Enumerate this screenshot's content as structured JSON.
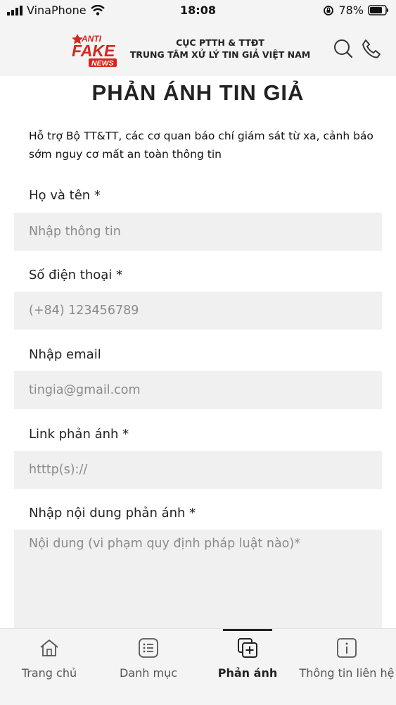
{
  "status_bar": {
    "carrier": "VinaPhone",
    "time": "18:08",
    "battery": "78%"
  },
  "header": {
    "logo": {
      "line1": "ANTI",
      "line2": "FAKE",
      "line3": "NEWS"
    },
    "org_line1": "CỤC PTTH & TTĐT",
    "org_line2": "TRUNG TÂM XỬ LÝ TIN GIẢ VIỆT NAM",
    "icons": [
      "search-icon",
      "phone-icon"
    ]
  },
  "page": {
    "title": "PHẢN ÁNH TIN GIẢ",
    "description": "Hỗ trợ Bộ TT&TT, các cơ quan báo chí giám sát từ xa, cảnh báo sớm nguy cơ mất an toàn thông tin"
  },
  "form": {
    "name": {
      "label": "Họ và tên *",
      "placeholder": "Nhập thông tin"
    },
    "phone": {
      "label": "Số điện thoại *",
      "placeholder": "(+84) 123456789"
    },
    "email": {
      "label": "Nhập email",
      "placeholder": "tingia@gmail.com"
    },
    "link": {
      "label": "Link phản ánh *",
      "placeholder": "htttp(s)://"
    },
    "content": {
      "label": "Nhập nội dung phản ánh *",
      "placeholder": "Nội dung (vi phạm quy định pháp luật nào)*"
    }
  },
  "tabbar": {
    "items": [
      {
        "label": "Trang chủ",
        "icon": "home-icon"
      },
      {
        "label": "Danh mục",
        "icon": "list-icon"
      },
      {
        "label": "Phản ánh",
        "icon": "add-report-icon",
        "active": true
      },
      {
        "label": "Thông tin liên hệ",
        "icon": "info-icon"
      }
    ]
  },
  "colors": {
    "logo_red": "#d7261e",
    "text": "#222222",
    "field_bg": "#f0f0f0"
  }
}
